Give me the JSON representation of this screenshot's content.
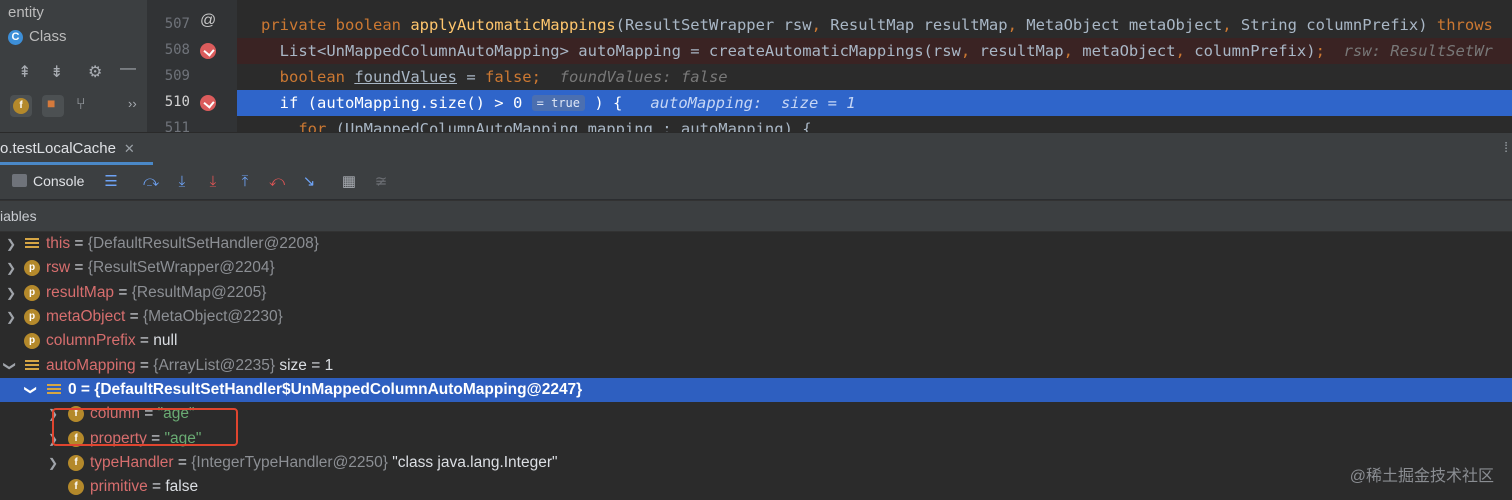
{
  "project": {
    "items": [
      {
        "label": "entity"
      },
      {
        "label": "Class",
        "icon": "class-icon"
      }
    ]
  },
  "editor": {
    "lines": [
      {
        "number": "507",
        "text": "private boolean applyAutomaticMappings(ResultSetWrapper rsw, ResultMap resultMap, MetaObject metaObject, String columnPrefix) throws"
      },
      {
        "number": "508",
        "text": "List<UnMappedColumnAutoMapping> autoMapping = createAutomaticMappings(rsw, resultMap, metaObject, columnPrefix);",
        "hint": "rsw: ResultSetWr"
      },
      {
        "number": "509",
        "text": "boolean foundValues = false;",
        "hint": "foundValues: false"
      },
      {
        "number": "510",
        "text": "if (autoMapping.size() > 0",
        "badge": "= true",
        "text2": ") {",
        "hint": "autoMapping:  size = 1"
      },
      {
        "number": "511",
        "text": "for (UnMappedColumnAutoMapping mapping : autoMapping) {"
      }
    ]
  },
  "debug": {
    "tab_label": "o.testLocalCache",
    "console_label": "Console",
    "variables_label": "iables"
  },
  "variables": [
    {
      "name": "this",
      "value": "{DefaultResultSetHandler@2208}"
    },
    {
      "name": "rsw",
      "value": "{ResultSetWrapper@2204}"
    },
    {
      "name": "resultMap",
      "value": "{ResultMap@2205}"
    },
    {
      "name": "metaObject",
      "value": "{MetaObject@2230}"
    },
    {
      "name": "columnPrefix",
      "value": "null"
    },
    {
      "name": "autoMapping",
      "value": "{ArrayList@2235}",
      "extra": "size = 1"
    },
    {
      "name": "0",
      "value": "{DefaultResultSetHandler$UnMappedColumnAutoMapping@2247}"
    },
    {
      "name": "column",
      "value": "\"age\""
    },
    {
      "name": "property",
      "value": "\"age\""
    },
    {
      "name": "typeHandler",
      "value": "{IntegerTypeHandler@2250}",
      "extra": "\"class java.lang.Integer\""
    },
    {
      "name": "primitive",
      "value": "false"
    }
  ],
  "watermark": "@稀土掘金技术社区",
  "colors": {
    "selection": "#2e5fc0",
    "highlight_box": "#e0452f",
    "breakpoint": "#db5c5c"
  }
}
